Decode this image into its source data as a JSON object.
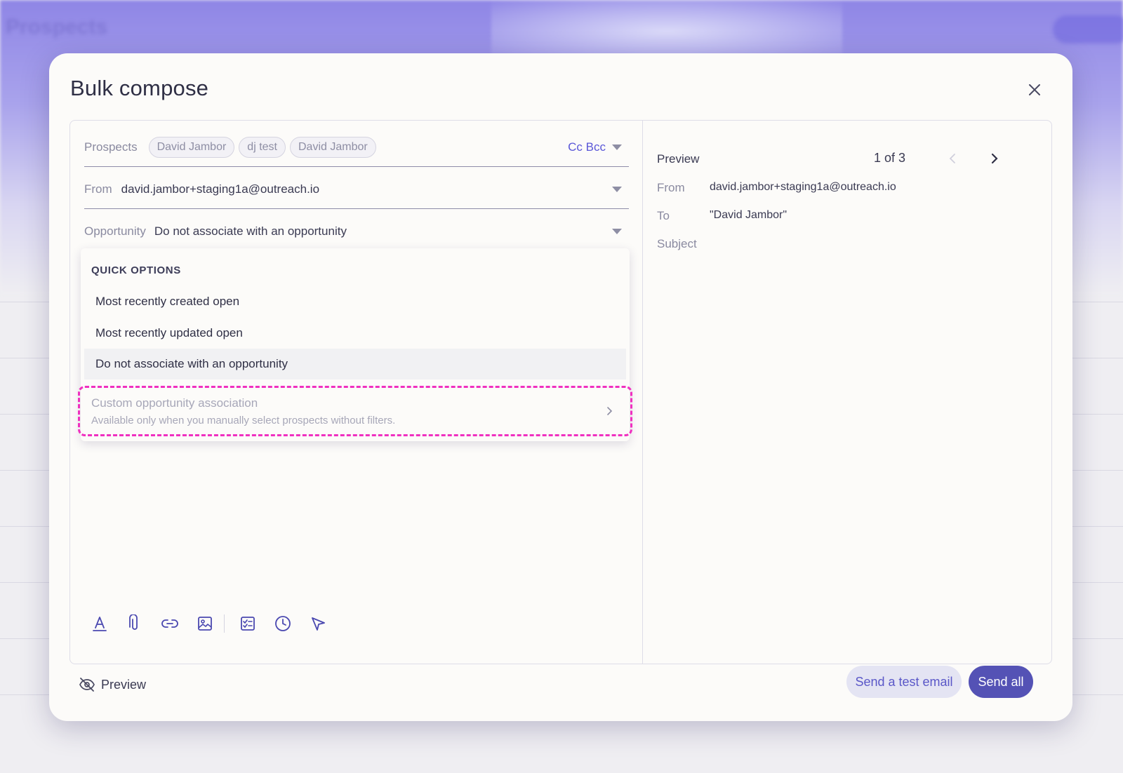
{
  "background": {
    "page_title": "Prospects"
  },
  "modal": {
    "title": "Bulk compose",
    "close_icon": "close-icon"
  },
  "compose": {
    "prospects_label": "Prospects",
    "prospects": [
      "David Jambor",
      "dj test",
      "David Jambor"
    ],
    "cc_bcc": "Cc Bcc",
    "from_label": "From",
    "from_value": "david.jambor+staging1a@outreach.io",
    "opportunity_label": "Opportunity",
    "opportunity_value": "Do not associate with an opportunity"
  },
  "dropdown": {
    "header": "QUICK OPTIONS",
    "items": [
      "Most recently created open",
      "Most recently updated open",
      "Do not associate with an opportunity"
    ],
    "selected_index": 2,
    "custom_title": "Custom opportunity association",
    "custom_subtitle": "Available only when you manually select prospects without filters."
  },
  "toolbar": {
    "icons": [
      "text-format-icon",
      "attachment-icon",
      "link-icon",
      "image-icon",
      "checklist-icon",
      "clock-icon",
      "send-cursor-icon"
    ]
  },
  "preview": {
    "title": "Preview",
    "page": "1 of 3",
    "from_label": "From",
    "from_value": "david.jambor+staging1a@outreach.io",
    "to_label": "To",
    "to_value": "\"David Jambor\"",
    "subject_label": "Subject"
  },
  "footer": {
    "preview_toggle": "Preview",
    "send_test": "Send a test email",
    "send_all": "Send all"
  },
  "colors": {
    "accent": "#5452b5",
    "link": "#5a57d8",
    "highlight_border": "#f030c0"
  }
}
